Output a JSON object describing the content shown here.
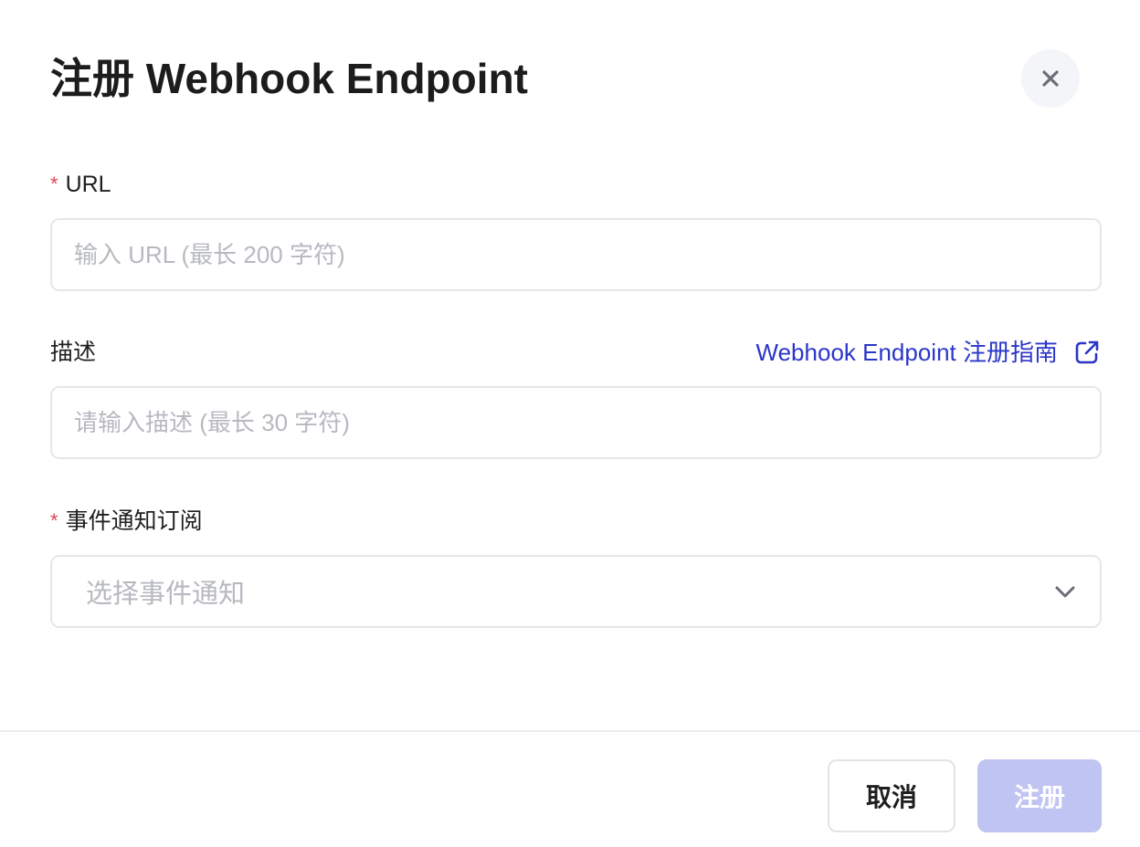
{
  "dialog": {
    "title": "注册 Webhook Endpoint",
    "close_icon": "close-icon"
  },
  "form": {
    "url": {
      "required_mark": "*",
      "label": "URL",
      "placeholder": "输入 URL (最长 200 字符)",
      "value": ""
    },
    "description": {
      "label": "描述",
      "placeholder": "请输入描述 (最长 30 字符)",
      "value": "",
      "guide_link": {
        "label": "Webhook Endpoint 注册指南",
        "icon": "external-link-icon"
      }
    },
    "events": {
      "required_mark": "*",
      "label": "事件通知订阅",
      "placeholder": "选择事件通知",
      "icon": "chevron-down-icon"
    }
  },
  "footer": {
    "cancel_label": "取消",
    "submit_label": "注册"
  },
  "colors": {
    "accent": "#2b36c9",
    "required": "#d9475a",
    "submit_disabled": "#bfc4f2",
    "border": "#e6e7eb",
    "placeholder": "#b7b9c0"
  }
}
